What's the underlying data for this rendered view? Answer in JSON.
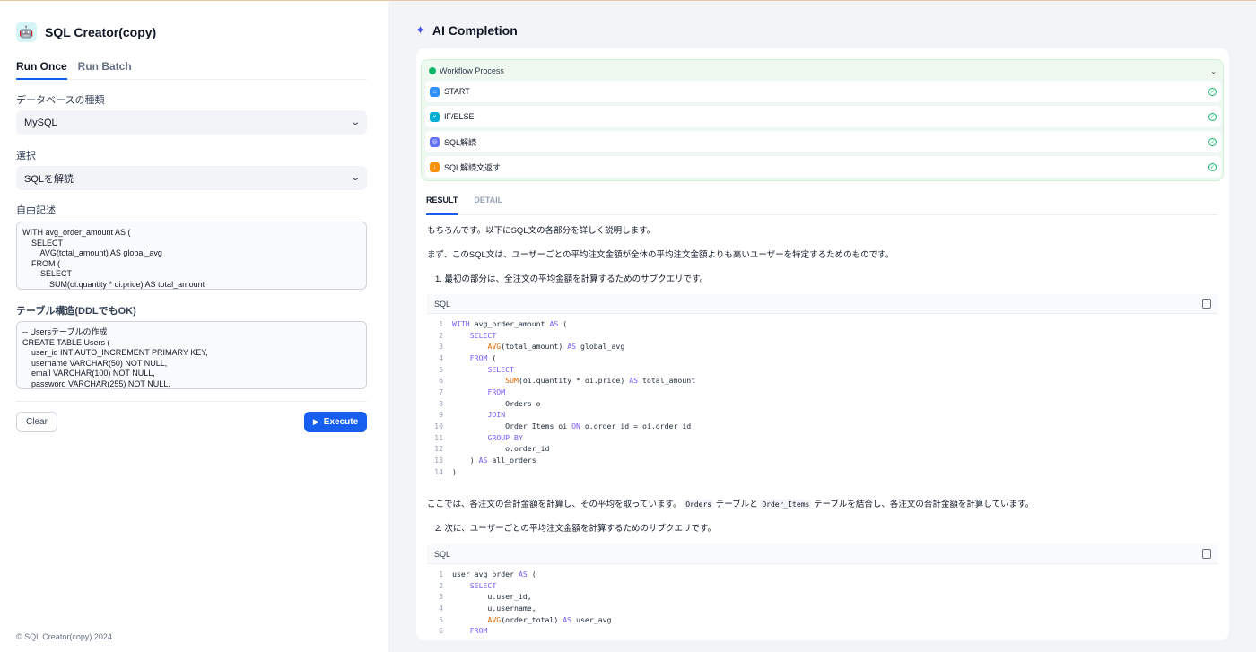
{
  "app": {
    "title": "SQL Creator(copy)",
    "icon": "robot-icon"
  },
  "tabs": [
    {
      "label": "Run Once",
      "active": true
    },
    {
      "label": "Run Batch",
      "active": false
    }
  ],
  "form": {
    "db_type": {
      "label": "データベースの種類",
      "value": "MySQL"
    },
    "choice": {
      "label": "選択",
      "value": "SQLを解読"
    },
    "free_text": {
      "label": "自由記述",
      "value": "WITH avg_order_amount AS (\n    SELECT\n        AVG(total_amount) AS global_avg\n    FROM (\n        SELECT\n            SUM(oi.quantity * oi.price) AS total_amount"
    },
    "table_structure": {
      "label": "テーブル構造(DDLでもOK)",
      "value": "-- Usersテーブルの作成\nCREATE TABLE Users (\n    user_id INT AUTO_INCREMENT PRIMARY KEY,\n    username VARCHAR(50) NOT NULL,\n    email VARCHAR(100) NOT NULL,\n    password VARCHAR(255) NOT NULL,"
    }
  },
  "buttons": {
    "clear": "Clear",
    "execute": "Execute"
  },
  "footer": "© SQL Creator(copy) 2024",
  "ai": {
    "title": "AI Completion",
    "workflow": {
      "title": "Workflow Process",
      "nodes": [
        {
          "label": "START",
          "color": "#2e90fa",
          "icon": "home-icon"
        },
        {
          "label": "IF/ELSE",
          "color": "#06aed4",
          "icon": "branch-icon"
        },
        {
          "label": "SQL解読",
          "color": "#6172f3",
          "icon": "llm-icon"
        },
        {
          "label": "SQL解読文返す",
          "color": "#f79009",
          "icon": "answer-icon"
        }
      ]
    },
    "result_tabs": [
      {
        "label": "RESULT",
        "active": true
      },
      {
        "label": "DETAIL",
        "active": false
      }
    ],
    "paragraphs": {
      "p1": "もちろんです。以下にSQL文の各部分を詳しく説明します。",
      "p2": "まず、このSQL文は、ユーザーごとの平均注文金額が全体の平均注文金額よりも高いユーザーを特定するためのものです。",
      "p3": "1. 最初の部分は、全注文の平均金額を計算するためのサブクエリです。",
      "p4a": "ここでは、各注文の合計金額を計算し、その平均を取っています。",
      "p4_code1": "Orders",
      "p4b": "テーブルと",
      "p4_code2": "Order_Items",
      "p4c": "テーブルを結合し、各注文の合計金額を計算しています。",
      "p5": "2. 次に、ユーザーごとの平均注文金額を計算するためのサブクエリです。"
    },
    "code_lang": "SQL",
    "code1": [
      "WITH avg_order_amount AS (",
      "    SELECT",
      "        AVG(total_amount) AS global_avg",
      "    FROM (",
      "        SELECT",
      "            SUM(oi.quantity * oi.price) AS total_amount",
      "        FROM",
      "            Orders o",
      "        JOIN",
      "            Order_Items oi ON o.order_id = oi.order_id",
      "        GROUP BY",
      "            o.order_id",
      "    ) AS all_orders",
      ")"
    ],
    "code2": [
      "user_avg_order AS (",
      "    SELECT",
      "        u.user_id,",
      "        u.username,",
      "        AVG(order_total) AS user_avg",
      "    FROM"
    ]
  }
}
